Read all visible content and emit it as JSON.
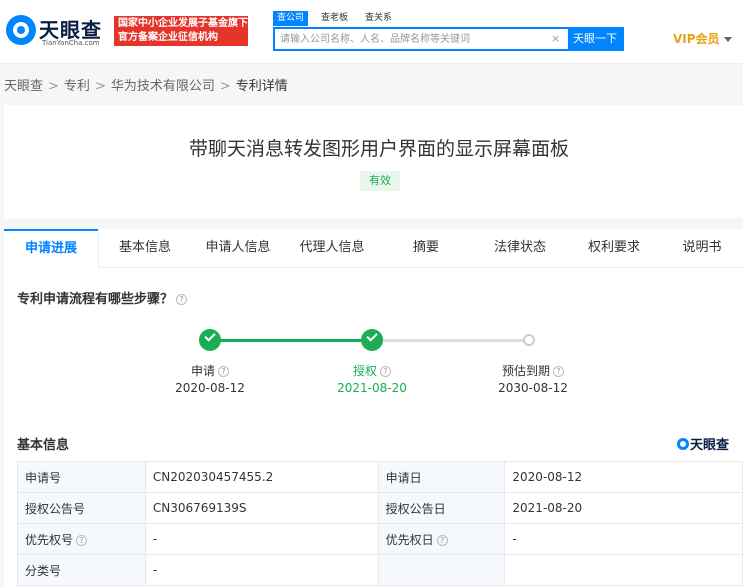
{
  "header": {
    "logo_cn": "天眼查",
    "logo_en": "TianYanCha.com",
    "badge_line1": "国家中小企业发展子基金旗下",
    "badge_line2": "官方备案企业征信机构",
    "search_tabs": [
      "查公司",
      "查老板",
      "查关系"
    ],
    "search_placeholder": "请输入公司名称、人名、品牌名称等关键词",
    "search_clear": "×",
    "search_button": "天眼一下",
    "vip_label": "VIP会员"
  },
  "breadcrumb": [
    "天眼查",
    "专利",
    "华为技术有限公司",
    "专利详情"
  ],
  "breadcrumb_sep": ">",
  "patent": {
    "title": "带聊天消息转发图形用户界面的显示屏幕面板",
    "status": "有效"
  },
  "tabs": [
    "申请进展",
    "基本信息",
    "申请人信息",
    "代理人信息",
    "摘要",
    "法律状态",
    "权利要求",
    "说明书"
  ],
  "progress": {
    "question": "专利申请流程有哪些步骤？",
    "help_icon": "?",
    "steps": [
      {
        "label": "申请",
        "date": "2020-08-12",
        "state": "done"
      },
      {
        "label": "授权",
        "date": "2021-08-20",
        "state": "current"
      },
      {
        "label": "预估到期",
        "date": "2030-08-12",
        "state": "pending"
      }
    ]
  },
  "basic_info": {
    "title": "基本信息",
    "brand": "天眼查",
    "rows": [
      {
        "k1": "申请号",
        "v1": "CN202030457455.2",
        "k2": "申请日",
        "v2": "2020-08-12"
      },
      {
        "k1": "授权公告号",
        "v1": "CN306769139S",
        "k2": "授权公告日",
        "v2": "2021-08-20"
      },
      {
        "k1": "优先权号",
        "v1": "-",
        "k2": "优先权日",
        "v2": "-"
      },
      {
        "k1": "分类号",
        "v1": "-",
        "k2": "",
        "v2": ""
      }
    ]
  },
  "colors": {
    "accent": "#0084ff",
    "success": "#1aad55",
    "brand_red": "#e5352b",
    "vip_gold": "#e8a117"
  }
}
